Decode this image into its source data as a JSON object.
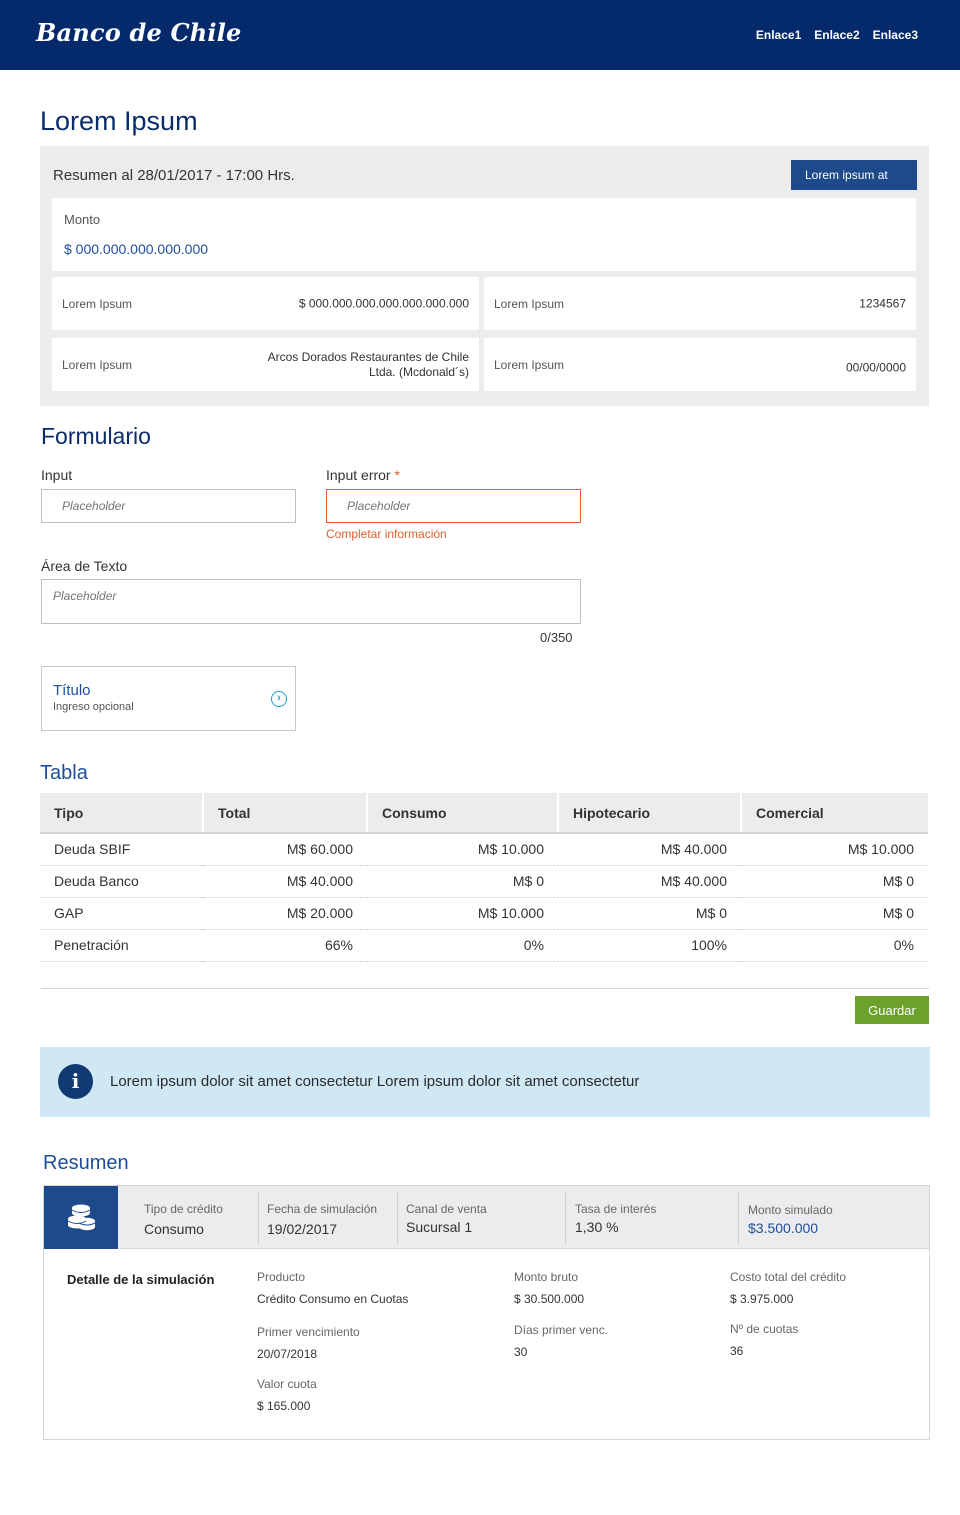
{
  "header": {
    "logo": "Banco de Chile",
    "links": [
      "Enlace1",
      "Enlace2",
      "Enlace3"
    ]
  },
  "page_title": "Lorem Ipsum",
  "summary": {
    "title": "Resumen al 28/01/2017 - 17:00 Hrs.",
    "button": "Lorem ipsum at",
    "monto_label": "Monto",
    "monto_value": "$ 000.000.000.000.000",
    "items": [
      {
        "label": "Lorem Ipsum",
        "value": "$ 000.000.000.000.000.000.000"
      },
      {
        "label": "Lorem Ipsum",
        "value": "1234567"
      },
      {
        "label": "Lorem Ipsum",
        "value_line1": "Arcos Dorados Restaurantes de Chile",
        "value_line2": "Ltda. (Mcdonald´s)"
      },
      {
        "label": "Lorem Ipsum",
        "value": "00/00/0000"
      }
    ]
  },
  "form": {
    "title": "Formulario",
    "input_label": "Input",
    "input_placeholder": "Placeholder",
    "input_error_label": "Input error",
    "required_mark": "*",
    "input_error_placeholder": "Placeholder",
    "error_message": "Completar información",
    "textarea_label": "Área de Texto",
    "textarea_placeholder": "Placeholder",
    "textarea_counter": "0/350",
    "card_title": "Título",
    "card_subtitle": "Ingreso opcional"
  },
  "table": {
    "title": "Tabla",
    "headers": [
      "Tipo",
      "Total",
      "Consumo",
      "Hipotecario",
      "Comercial"
    ],
    "rows": [
      [
        "Deuda SBIF",
        "M$ 60.000",
        "M$ 10.000",
        "M$ 40.000",
        "M$ 10.000"
      ],
      [
        "Deuda Banco",
        "M$ 40.000",
        "M$ 0",
        "M$ 40.000",
        "M$ 0"
      ],
      [
        "GAP",
        "M$ 20.000",
        "M$ 10.000",
        "M$ 0",
        "M$ 0"
      ],
      [
        "Penetración",
        "66%",
        "0%",
        "100%",
        "0%"
      ]
    ],
    "save_button": "Guardar"
  },
  "info": {
    "icon": "info-icon",
    "text": "Lorem ipsum dolor sit amet consectetur Lorem ipsum dolor sit amet consectetur"
  },
  "simulation": {
    "title": "Resumen",
    "icon": "coins-icon",
    "header": [
      {
        "label": "Tipo de crédito",
        "value": "Consumo"
      },
      {
        "label": "Fecha de simulación",
        "value": "19/02/2017"
      },
      {
        "label": "Canal de venta",
        "value": "Sucursal 1"
      },
      {
        "label": "Tasa de interés",
        "value": "1,30 %"
      },
      {
        "label": "Monto simulado",
        "value": "$3.500.000"
      }
    ],
    "detail_title": "Detalle de la simulación",
    "fields": [
      {
        "label": "Producto",
        "value": "Crédito Consumo en Cuotas"
      },
      {
        "label": "Monto bruto",
        "value": "$ 30.500.000"
      },
      {
        "label": "Costo total del crédito",
        "value": "$ 3.975.000"
      },
      {
        "label": "Primer vencimiento",
        "value": "20/07/2018"
      },
      {
        "label": "Días primer venc.",
        "value": "30"
      },
      {
        "label": "Nº de cuotas",
        "value": "36"
      },
      {
        "label": "Valor cuota",
        "value": "$ 165.000"
      }
    ],
    "accent_color": "#1d4f99"
  },
  "colors": {
    "header_bg": "#042a6b",
    "primary_button": "#1d4a8a",
    "save_button": "#6ca12b",
    "error": "#e0602d",
    "info_bg": "#cfe8f3"
  }
}
